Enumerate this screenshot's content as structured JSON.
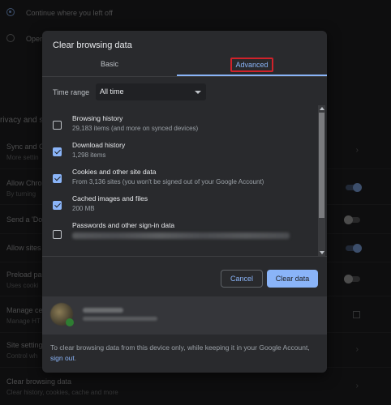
{
  "background": {
    "radio_continue": "Continue where you left off",
    "radio_open": "Open",
    "section_privacy": "rivacy and s",
    "sync_title": "Sync and G",
    "sync_sub": "More settin",
    "allow_chrome_title": "Allow Chro",
    "allow_chrome_sub": "By turning",
    "send_do_title": "Send a 'Do",
    "allow_sites_title": "Allow sites",
    "preload_title": "Preload pa",
    "preload_sub": "Uses cooki",
    "manage_title": "Manage ce",
    "manage_sub": "Manage HT",
    "site_settings_title": "Site setting",
    "site_settings_sub": "Control wh",
    "clear_title": "Clear browsing data",
    "clear_sub": "Clear history, cookies, cache and more"
  },
  "dialog": {
    "title": "Clear browsing data",
    "tabs": {
      "basic": "Basic",
      "advanced": "Advanced"
    },
    "time_range": {
      "label": "Time range",
      "value": "All time"
    },
    "items": [
      {
        "title": "Browsing history",
        "sub": "29,183 items (and more on synced devices)",
        "checked": false
      },
      {
        "title": "Download history",
        "sub": "1,298 items",
        "checked": true
      },
      {
        "title": "Cookies and other site data",
        "sub": "From 3,136 sites (you won't be signed out of your Google Account)",
        "checked": true
      },
      {
        "title": "Cached images and files",
        "sub": "200 MB",
        "checked": true
      },
      {
        "title": "Passwords and other sign-in data",
        "sub": "",
        "checked": false
      }
    ],
    "buttons": {
      "cancel": "Cancel",
      "clear": "Clear data"
    },
    "footer": {
      "text_1": "To clear browsing data from this device only, while keeping it in your Google Account, ",
      "link": "sign out",
      "text_2": "."
    }
  },
  "colors": {
    "accent": "#8ab4f8",
    "dialog_bg": "#292a2d",
    "highlight_box": "#d0222a"
  }
}
